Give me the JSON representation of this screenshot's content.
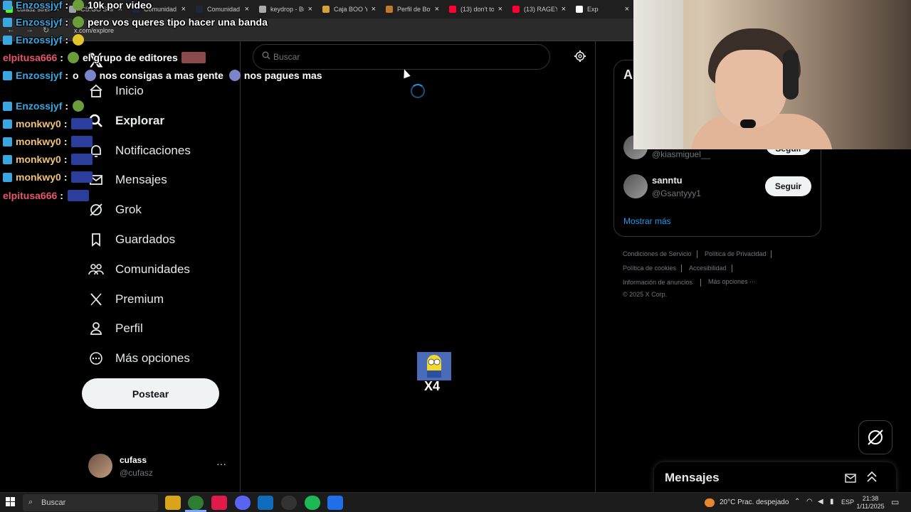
{
  "browser": {
    "tabs": [
      {
        "label": "cufasz stream",
        "color": "#53fc18"
      },
      {
        "label": "CS:GO Skin",
        "color": "#9aa0a6"
      },
      {
        "label": "Comunidad",
        "color": "#1b2838"
      },
      {
        "label": "Comunidad",
        "color": "#1b2838"
      },
      {
        "label": "keydrop - Bu",
        "color": "#aaaaaa"
      },
      {
        "label": "Caja BOO Yo",
        "color": "#d4a03a"
      },
      {
        "label": "Perfil de Bot",
        "color": "#c07a2c"
      },
      {
        "label": "(13) don't to",
        "color": "#ff0033"
      },
      {
        "label": "(13) RAGEYL",
        "color": "#ff0033"
      },
      {
        "label": "Exp",
        "color": "#ffffff"
      }
    ],
    "url": "x.com/explore"
  },
  "nav": {
    "items": [
      {
        "label": "Inicio",
        "icon": "home-icon"
      },
      {
        "label": "Explorar",
        "icon": "search-icon"
      },
      {
        "label": "Notificaciones",
        "icon": "bell-icon"
      },
      {
        "label": "Mensajes",
        "icon": "mail-icon"
      },
      {
        "label": "Grok",
        "icon": "grok-icon"
      },
      {
        "label": "Guardados",
        "icon": "bookmark-icon"
      },
      {
        "label": "Comunidades",
        "icon": "people-icon"
      },
      {
        "label": "Premium",
        "icon": "x-icon"
      },
      {
        "label": "Perfil",
        "icon": "person-icon"
      },
      {
        "label": "Más opciones",
        "icon": "more-circle-icon"
      }
    ],
    "post_label": "Postear",
    "account": {
      "name": "cufass",
      "handle": "@cufasz",
      "more": "···"
    }
  },
  "search": {
    "placeholder": "Buscar"
  },
  "minion": {
    "label": "X4"
  },
  "right": {
    "title_fragment": "A",
    "suggestions": [
      {
        "name": "",
        "handle": "@kiasmiguel__",
        "button": "Seguir"
      },
      {
        "name": "sanntu",
        "handle": "@Gsantyyy1",
        "button": "Seguir"
      }
    ],
    "show_more": "Mostrar más",
    "footer": [
      "Condiciones de Servicio",
      "Política de Privacidad",
      "Política de cookies",
      "Accesibilidad",
      "Información de anuncios",
      "Más opciones ···",
      "© 2025 X Corp."
    ]
  },
  "messages": {
    "title": "Mensajes"
  },
  "chat": [
    {
      "user": "Enzossjyf",
      "color": "#3aa7e0",
      "msg": "10k por video",
      "emote": "green"
    },
    {
      "user": "Enzossjyf",
      "color": "#3aa7e0",
      "msg": "pero vos queres tipo hacer una banda",
      "emote": "green"
    },
    {
      "user": "Enzossjyf",
      "color": "#3aa7e0",
      "msg": "",
      "emote": "yellow"
    },
    {
      "user": "elpitusa666",
      "color": "#e8566a",
      "msg": "el grupo de editores",
      "emote": "pic",
      "nobadge": true
    },
    {
      "user": "Enzossjyf",
      "color": "#3aa7e0",
      "msg": "o",
      "emote": "none",
      "extra": "nos consigas a mas gente",
      "extra2": "nos pagues mas"
    },
    {
      "user": "Enzossjyf",
      "color": "#3aa7e0",
      "msg": "",
      "emote": "green"
    },
    {
      "user": "monkwy0",
      "color": "#f0c27a",
      "msg": "",
      "emote": "blue"
    },
    {
      "user": "monkwy0",
      "color": "#f0c27a",
      "msg": "",
      "emote": "blue"
    },
    {
      "user": "monkwy0",
      "color": "#f0c27a",
      "msg": "",
      "emote": "blue"
    },
    {
      "user": "monkwy0",
      "color": "#f0c27a",
      "msg": "",
      "emote": "blue"
    },
    {
      "user": "elpitusa666",
      "color": "#e8566a",
      "msg": "",
      "emote": "blue",
      "nobadge": true
    }
  ],
  "taskbar": {
    "search_placeholder": "Buscar",
    "weather": "20°C  Prac. despejado",
    "lang": "ESP",
    "time": "21:38",
    "date": "1/11/2025"
  }
}
